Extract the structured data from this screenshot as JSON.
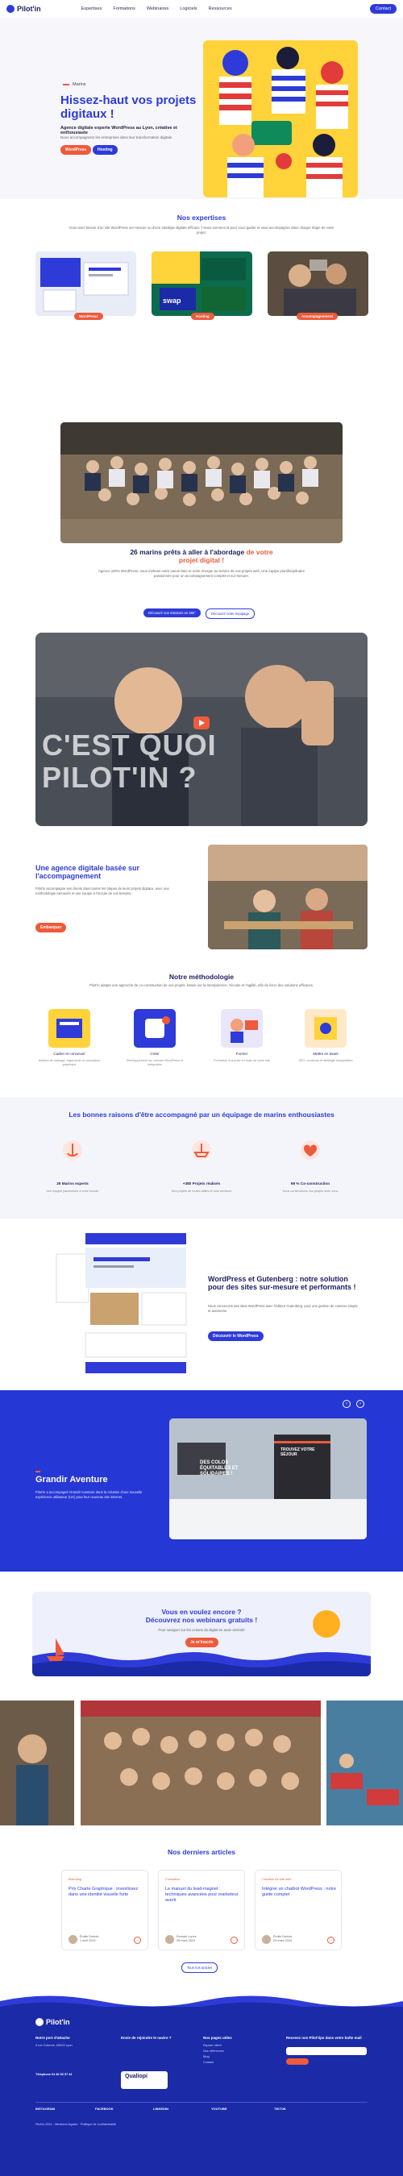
{
  "nav": {
    "logo": "Pilot'in",
    "items": [
      "Expertises",
      "Formations",
      "Webinaires",
      "Logiciels",
      "Ressources"
    ],
    "cta": "Contact"
  },
  "hero": {
    "eyebrow": "Marins",
    "title": "Hissez-haut vos projets digitaux !",
    "subtitle": "Agence digitale experte WordPress au Lyon, créative et enthousiaste",
    "micro": "Nous accompagnons les entreprises dans leur transformation digitale.",
    "btn1": "WordPress",
    "btn2": "Hosting"
  },
  "expertises": {
    "title": "Nos expertises",
    "text": "Vous avez besoin d'un site WordPress sur-mesure ou d'une stratégie digitale efficace ? Nous sommes là pour vous guider et vous accompagner dans chaque étape de votre projet.",
    "cards": [
      "WordPress",
      "Hosting",
      "Accompagnement"
    ]
  },
  "crew": {
    "title_a": "26 marins prêts à aller à l'abordage",
    "title_b": "de votre",
    "title_c": "projet digital !",
    "text": "Agence 100% WordPress, nous mettons notre savoir-faire et notre énergie au service de vos projets web. Une équipe pluridisciplinaire passionnée pour un accompagnement complet et sur-mesure.",
    "btn1": "Découvrir nos missions en 360°",
    "btn2": "Découvrir notre équipage"
  },
  "video": {
    "line1": "C'EST QUOI",
    "line2": "PILOT'IN ?"
  },
  "agency": {
    "title": "Une agence digitale basée sur l'accompagnement",
    "text": "Pilot'in accompagne ses clients dans toutes les étapes de leurs projets digitaux, avec une méthodologie éprouvée et une équipe à l'écoute de vos besoins.",
    "btn": "Embarquer"
  },
  "method": {
    "title": "Notre méthodologie",
    "text": "Pilot'in adopte une approche de co-construction de vos projets, basée sur la transparence, l'écoute et l'agilité, afin de livrer des solutions efficaces.",
    "steps": [
      {
        "label": "Cadrer et concevoir",
        "desc": "Ateliers de cadrage, ergonomie et conception graphique"
      },
      {
        "label": "Créer",
        "desc": "Développement sur-mesure WordPress et intégration"
      },
      {
        "label": "Former",
        "desc": "Formation à la prise en main de votre site"
      },
      {
        "label": "Mettre en avant",
        "desc": "SEO, contenus et stratégie d'acquisition"
      }
    ]
  },
  "reasons": {
    "title": "Les bonnes raisons d'être accompagné par un équipage de marins enthousiastes",
    "items": [
      {
        "label": "26 Marins experts",
        "desc": "Une équipe passionnée à votre écoute"
      },
      {
        "label": "+380 Projets réalisés",
        "desc": "Des projets de toutes tailles et tous secteurs"
      },
      {
        "label": "98 % Co-construction",
        "desc": "Nous construisons vos projets avec vous"
      }
    ]
  },
  "wp": {
    "title": "WordPress et Gutenberg : notre solution pour des sites sur-mesure et performants !",
    "text": "Nous concevons des sites WordPress avec l'éditeur Gutenberg, pour une gestion de contenu simple et autonome.",
    "btn": "Découvrir le WordPress"
  },
  "project": {
    "title": "Grandir Aventure",
    "text": "Pilot'in a accompagné Grandir Aventure dans la création d'une nouvelle expérience utilisateur (UX) pour leur nouveau site internet.",
    "overlay": "DES COLOS ÉQUITABLES ET SOLIDAIRES !",
    "form_title": "TROUVEZ VOTRE SÉJOUR"
  },
  "webinar": {
    "title_a": "Vous en voulez encore ?",
    "title_b": "Découvrez nos webinars gratuits !",
    "text": "Pour naviguer sur les océans du digital en toute sérénité",
    "btn": "Je m'inscris"
  },
  "articles": {
    "title": "Nos derniers articles",
    "items": [
      {
        "cat": "Branding",
        "title": "Prix Charte Graphique : investissez dans une identité visuelle forte",
        "author": "Émilie Dubois",
        "date": "1 avril 2024"
      },
      {
        "cat": "Formation",
        "title": "Le manuel du lead-magnet : techniques avancées pour marketeur averti",
        "author": "Romain Lopez",
        "date": "28 mars 2024"
      },
      {
        "cat": "Création de site web",
        "title": "Intégrer un chatbot WordPress : notre guide complet",
        "author": "Émilie Dubois",
        "date": "25 mars 2024"
      }
    ],
    "btn": "Tous nos articles"
  },
  "footer": {
    "logo": "Pilot'in",
    "col1_t": "Notre port d'attache",
    "col1_p": "5 rue Colonne, 69003 Lyon",
    "col2_t": "Envie de rejoindre le navire ?",
    "col3_t": "Nos pages utiles",
    "col3_p": [
      "Espace client",
      "Nos références",
      "Blog",
      "Contact"
    ],
    "col4_t": "Recevez nos Pilot'tips dans votre boîte mail",
    "phone": "Téléphone 04 82 53 57 44",
    "qualiopi": "Qualiopi",
    "social": [
      "INSTAGRAM",
      "FACEBOOK",
      "LINKEDIN",
      "YOUTUBE",
      "TIKTOK"
    ],
    "legal": "Pilot'in 2024 · Mentions légales · Politique de confidentialité"
  }
}
